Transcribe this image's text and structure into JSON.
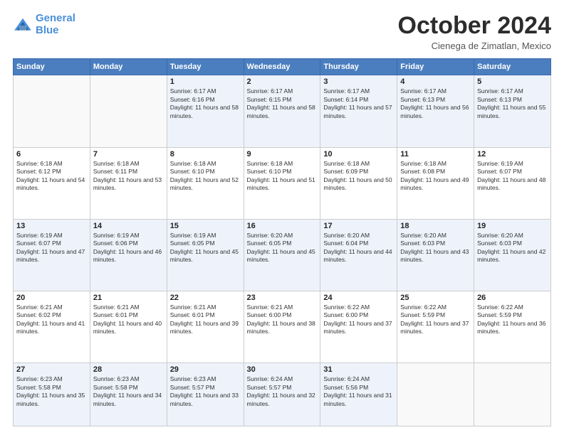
{
  "header": {
    "logo_line1": "General",
    "logo_line2": "Blue",
    "month": "October 2024",
    "location": "Cienega de Zimatlan, Mexico"
  },
  "days_of_week": [
    "Sunday",
    "Monday",
    "Tuesday",
    "Wednesday",
    "Thursday",
    "Friday",
    "Saturday"
  ],
  "weeks": [
    [
      {
        "day": "",
        "info": ""
      },
      {
        "day": "",
        "info": ""
      },
      {
        "day": "1",
        "sunrise": "Sunrise: 6:17 AM",
        "sunset": "Sunset: 6:16 PM",
        "daylight": "Daylight: 11 hours and 58 minutes."
      },
      {
        "day": "2",
        "sunrise": "Sunrise: 6:17 AM",
        "sunset": "Sunset: 6:15 PM",
        "daylight": "Daylight: 11 hours and 58 minutes."
      },
      {
        "day": "3",
        "sunrise": "Sunrise: 6:17 AM",
        "sunset": "Sunset: 6:14 PM",
        "daylight": "Daylight: 11 hours and 57 minutes."
      },
      {
        "day": "4",
        "sunrise": "Sunrise: 6:17 AM",
        "sunset": "Sunset: 6:13 PM",
        "daylight": "Daylight: 11 hours and 56 minutes."
      },
      {
        "day": "5",
        "sunrise": "Sunrise: 6:17 AM",
        "sunset": "Sunset: 6:13 PM",
        "daylight": "Daylight: 11 hours and 55 minutes."
      }
    ],
    [
      {
        "day": "6",
        "sunrise": "Sunrise: 6:18 AM",
        "sunset": "Sunset: 6:12 PM",
        "daylight": "Daylight: 11 hours and 54 minutes."
      },
      {
        "day": "7",
        "sunrise": "Sunrise: 6:18 AM",
        "sunset": "Sunset: 6:11 PM",
        "daylight": "Daylight: 11 hours and 53 minutes."
      },
      {
        "day": "8",
        "sunrise": "Sunrise: 6:18 AM",
        "sunset": "Sunset: 6:10 PM",
        "daylight": "Daylight: 11 hours and 52 minutes."
      },
      {
        "day": "9",
        "sunrise": "Sunrise: 6:18 AM",
        "sunset": "Sunset: 6:10 PM",
        "daylight": "Daylight: 11 hours and 51 minutes."
      },
      {
        "day": "10",
        "sunrise": "Sunrise: 6:18 AM",
        "sunset": "Sunset: 6:09 PM",
        "daylight": "Daylight: 11 hours and 50 minutes."
      },
      {
        "day": "11",
        "sunrise": "Sunrise: 6:18 AM",
        "sunset": "Sunset: 6:08 PM",
        "daylight": "Daylight: 11 hours and 49 minutes."
      },
      {
        "day": "12",
        "sunrise": "Sunrise: 6:19 AM",
        "sunset": "Sunset: 6:07 PM",
        "daylight": "Daylight: 11 hours and 48 minutes."
      }
    ],
    [
      {
        "day": "13",
        "sunrise": "Sunrise: 6:19 AM",
        "sunset": "Sunset: 6:07 PM",
        "daylight": "Daylight: 11 hours and 47 minutes."
      },
      {
        "day": "14",
        "sunrise": "Sunrise: 6:19 AM",
        "sunset": "Sunset: 6:06 PM",
        "daylight": "Daylight: 11 hours and 46 minutes."
      },
      {
        "day": "15",
        "sunrise": "Sunrise: 6:19 AM",
        "sunset": "Sunset: 6:05 PM",
        "daylight": "Daylight: 11 hours and 45 minutes."
      },
      {
        "day": "16",
        "sunrise": "Sunrise: 6:20 AM",
        "sunset": "Sunset: 6:05 PM",
        "daylight": "Daylight: 11 hours and 45 minutes."
      },
      {
        "day": "17",
        "sunrise": "Sunrise: 6:20 AM",
        "sunset": "Sunset: 6:04 PM",
        "daylight": "Daylight: 11 hours and 44 minutes."
      },
      {
        "day": "18",
        "sunrise": "Sunrise: 6:20 AM",
        "sunset": "Sunset: 6:03 PM",
        "daylight": "Daylight: 11 hours and 43 minutes."
      },
      {
        "day": "19",
        "sunrise": "Sunrise: 6:20 AM",
        "sunset": "Sunset: 6:03 PM",
        "daylight": "Daylight: 11 hours and 42 minutes."
      }
    ],
    [
      {
        "day": "20",
        "sunrise": "Sunrise: 6:21 AM",
        "sunset": "Sunset: 6:02 PM",
        "daylight": "Daylight: 11 hours and 41 minutes."
      },
      {
        "day": "21",
        "sunrise": "Sunrise: 6:21 AM",
        "sunset": "Sunset: 6:01 PM",
        "daylight": "Daylight: 11 hours and 40 minutes."
      },
      {
        "day": "22",
        "sunrise": "Sunrise: 6:21 AM",
        "sunset": "Sunset: 6:01 PM",
        "daylight": "Daylight: 11 hours and 39 minutes."
      },
      {
        "day": "23",
        "sunrise": "Sunrise: 6:21 AM",
        "sunset": "Sunset: 6:00 PM",
        "daylight": "Daylight: 11 hours and 38 minutes."
      },
      {
        "day": "24",
        "sunrise": "Sunrise: 6:22 AM",
        "sunset": "Sunset: 6:00 PM",
        "daylight": "Daylight: 11 hours and 37 minutes."
      },
      {
        "day": "25",
        "sunrise": "Sunrise: 6:22 AM",
        "sunset": "Sunset: 5:59 PM",
        "daylight": "Daylight: 11 hours and 37 minutes."
      },
      {
        "day": "26",
        "sunrise": "Sunrise: 6:22 AM",
        "sunset": "Sunset: 5:59 PM",
        "daylight": "Daylight: 11 hours and 36 minutes."
      }
    ],
    [
      {
        "day": "27",
        "sunrise": "Sunrise: 6:23 AM",
        "sunset": "Sunset: 5:58 PM",
        "daylight": "Daylight: 11 hours and 35 minutes."
      },
      {
        "day": "28",
        "sunrise": "Sunrise: 6:23 AM",
        "sunset": "Sunset: 5:58 PM",
        "daylight": "Daylight: 11 hours and 34 minutes."
      },
      {
        "day": "29",
        "sunrise": "Sunrise: 6:23 AM",
        "sunset": "Sunset: 5:57 PM",
        "daylight": "Daylight: 11 hours and 33 minutes."
      },
      {
        "day": "30",
        "sunrise": "Sunrise: 6:24 AM",
        "sunset": "Sunset: 5:57 PM",
        "daylight": "Daylight: 11 hours and 32 minutes."
      },
      {
        "day": "31",
        "sunrise": "Sunrise: 6:24 AM",
        "sunset": "Sunset: 5:56 PM",
        "daylight": "Daylight: 11 hours and 31 minutes."
      },
      {
        "day": "",
        "info": ""
      },
      {
        "day": "",
        "info": ""
      }
    ]
  ]
}
